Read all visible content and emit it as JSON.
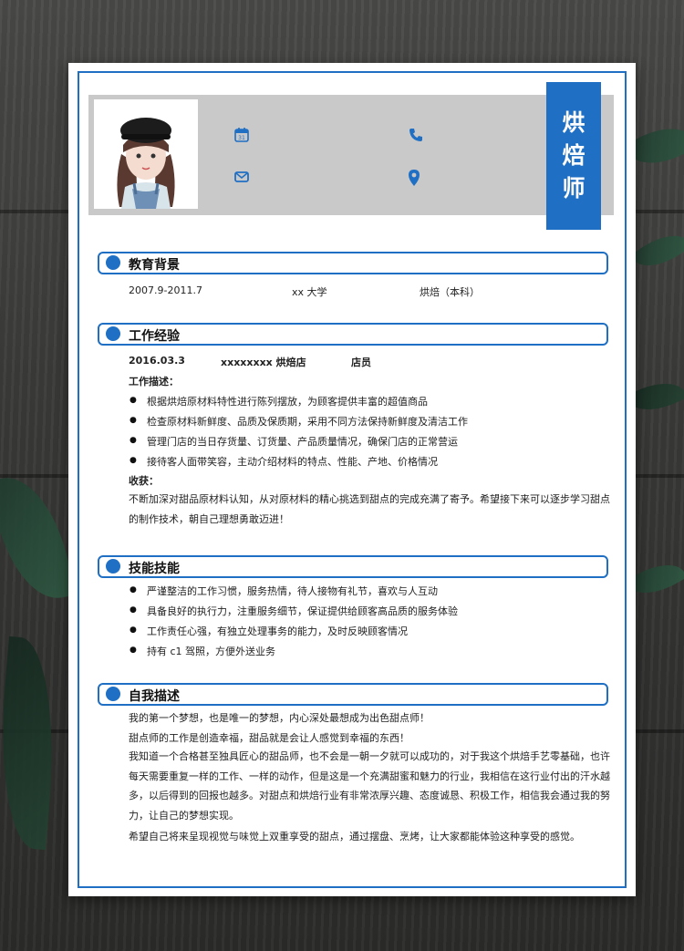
{
  "header": {
    "title_chars": [
      "烘",
      "焙",
      "师"
    ],
    "contact_icons": [
      "calendar-icon",
      "phone-icon",
      "email-icon",
      "location-icon"
    ]
  },
  "colors": {
    "accent": "#1f6fc4",
    "band": "#c9c9c9"
  },
  "education": {
    "title": "教育背景",
    "period": "2007.9-2011.7",
    "school": "xx 大学",
    "major": "烘焙（本科）"
  },
  "work": {
    "title": "工作经验",
    "date": "2016.03.3",
    "company": "xxxxxxxx 烘焙店",
    "position": "店员",
    "desc_label": "工作描述：",
    "items": [
      "根据烘焙原材料特性进行陈列摆放，为顾客提供丰富的超值商品",
      "检查原材料新鲜度、品质及保质期，采用不同方法保持新鲜度及清洁工作",
      "管理门店的当日存货量、订货量、产品质量情况，确保门店的正常营运",
      "接待客人面带笑容，主动介绍材料的特点、性能、产地、价格情况"
    ],
    "gain_label": "收获：",
    "gain_text": "不断加深对甜品原材料认知，从对原材料的精心挑选到甜点的完成充满了寄予。希望接下来可以逐步学习甜点的制作技术，朝自己理想勇敢迈进！"
  },
  "skills": {
    "title": "技能技能",
    "items": [
      "严谨整洁的工作习惯，服务热情，待人接物有礼节，喜欢与人互动",
      "具备良好的执行力，注重服务细节，保证提供给顾客高品质的服务体验",
      "工作责任心强，有独立处理事务的能力，及时反映顾客情况",
      "持有 c1 驾照，方便外送业务"
    ]
  },
  "self": {
    "title": "自我描述",
    "line1": "我的第一个梦想，也是唯一的梦想，内心深处最想成为出色甜点师！",
    "line2": "甜点师的工作是创造幸福，甜品就是会让人感觉到幸福的东西！",
    "para": "我知道一个合格甚至独具匠心的甜品师，也不会是一朝一夕就可以成功的，对于我这个烘焙手艺零基础，也许每天需要重复一样的工作、一样的动作，但是这是一个充满甜蜜和魅力的行业，我相信在这行业付出的汗水越多，以后得到的回报也越多。对甜点和烘焙行业有非常浓厚兴趣、态度诚恳、积极工作，相信我会通过我的努力，让自己的梦想实现。",
    "last": "希望自己将来呈现视觉与味觉上双重享受的甜点，通过摆盘、烹烤，让大家都能体验这种享受的感觉。"
  }
}
